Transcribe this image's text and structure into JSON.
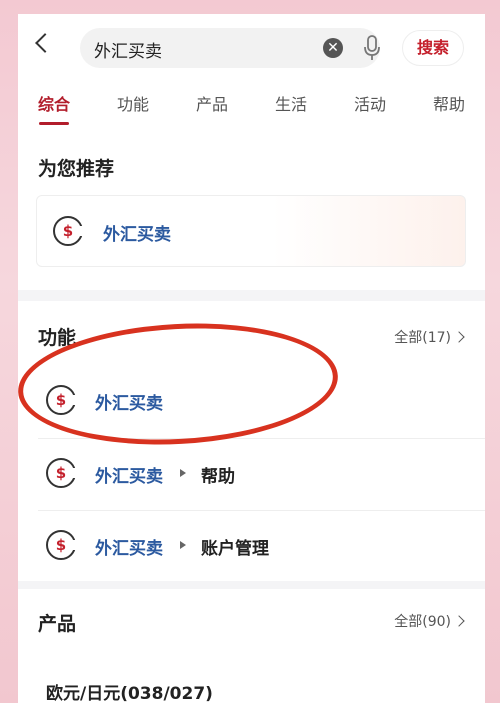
{
  "search": {
    "query": "外汇买卖",
    "button_label": "搜索"
  },
  "tabs": [
    {
      "label": "综合",
      "active": true
    },
    {
      "label": "功能"
    },
    {
      "label": "产品"
    },
    {
      "label": "生活"
    },
    {
      "label": "活动"
    },
    {
      "label": "帮助"
    }
  ],
  "recommend": {
    "title": "为您推荐",
    "item": {
      "label": "外汇买卖",
      "icon": "dollar-circle-icon"
    }
  },
  "functions": {
    "title": "功能",
    "more_label": "全部(17)",
    "items": [
      {
        "label": "外汇买卖",
        "sub": ""
      },
      {
        "label": "外汇买卖",
        "sub": "帮助"
      },
      {
        "label": "外汇买卖",
        "sub": "账户管理"
      }
    ]
  },
  "products": {
    "title": "产品",
    "more_label": "全部(90)",
    "items": [
      {
        "label": "欧元/日元(038/027)"
      }
    ]
  },
  "colors": {
    "brand_red": "#b21d2b",
    "link_blue": "#2c5aa0",
    "annotation_red": "#d8321f"
  }
}
